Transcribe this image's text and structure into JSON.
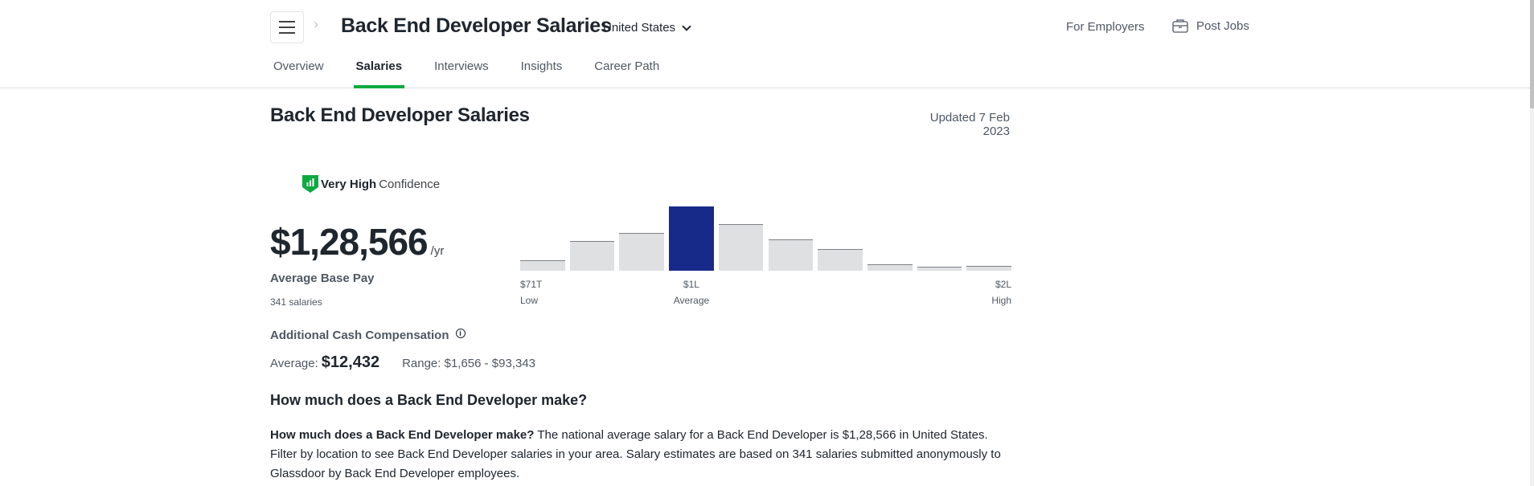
{
  "header": {
    "title": "Back End Developer Salaries",
    "location": "United States",
    "for_employers": "For Employers",
    "post_jobs": "Post Jobs"
  },
  "tabs": [
    {
      "label": "Overview",
      "active": false
    },
    {
      "label": "Salaries",
      "active": true
    },
    {
      "label": "Interviews",
      "active": false
    },
    {
      "label": "Insights",
      "active": false
    },
    {
      "label": "Career Path",
      "active": false
    }
  ],
  "section": {
    "title": "Back End Developer Salaries",
    "updated": "Updated 7 Feb 2023"
  },
  "confidence": {
    "level": "Very High",
    "suffix": "Confidence",
    "badge_color": "#0caa41"
  },
  "pay": {
    "amount": "$1,28,566",
    "unit": "/yr",
    "label": "Average Base Pay",
    "count": "341 salaries"
  },
  "chart_data": {
    "type": "bar",
    "title": "",
    "categories": [
      "1",
      "2",
      "3",
      "4",
      "5",
      "6",
      "7",
      "8",
      "9",
      "10"
    ],
    "values": [
      13,
      37,
      47,
      80,
      58,
      39,
      27,
      8,
      5,
      6
    ],
    "highlight_index": 3,
    "ylim": [
      0,
      80
    ],
    "colors": {
      "bar": "#dfe0e2",
      "highlight": "#172a8a",
      "bar_top": "#7d8085"
    },
    "ticks": [
      {
        "value": "$71T",
        "label": "Low",
        "position": "left"
      },
      {
        "value": "$1L",
        "label": "Average",
        "position": "bar-4"
      },
      {
        "value": "$2L",
        "label": "High",
        "position": "right"
      }
    ]
  },
  "additional": {
    "title": "Additional Cash Compensation",
    "average_label": "Average:",
    "average_value": "$12,432",
    "range": "Range: $1,656 - $93,343"
  },
  "faq": {
    "title": "How much does a Back End Developer make?",
    "lead": "How much does a Back End Developer make?",
    "body": " The national average salary for a Back End Developer is $1,28,566 in United States. Filter by location to see Back End Developer salaries in your area. Salary estimates are based on 341 salaries submitted anonymously to Glassdoor by Back End Developer employees."
  }
}
